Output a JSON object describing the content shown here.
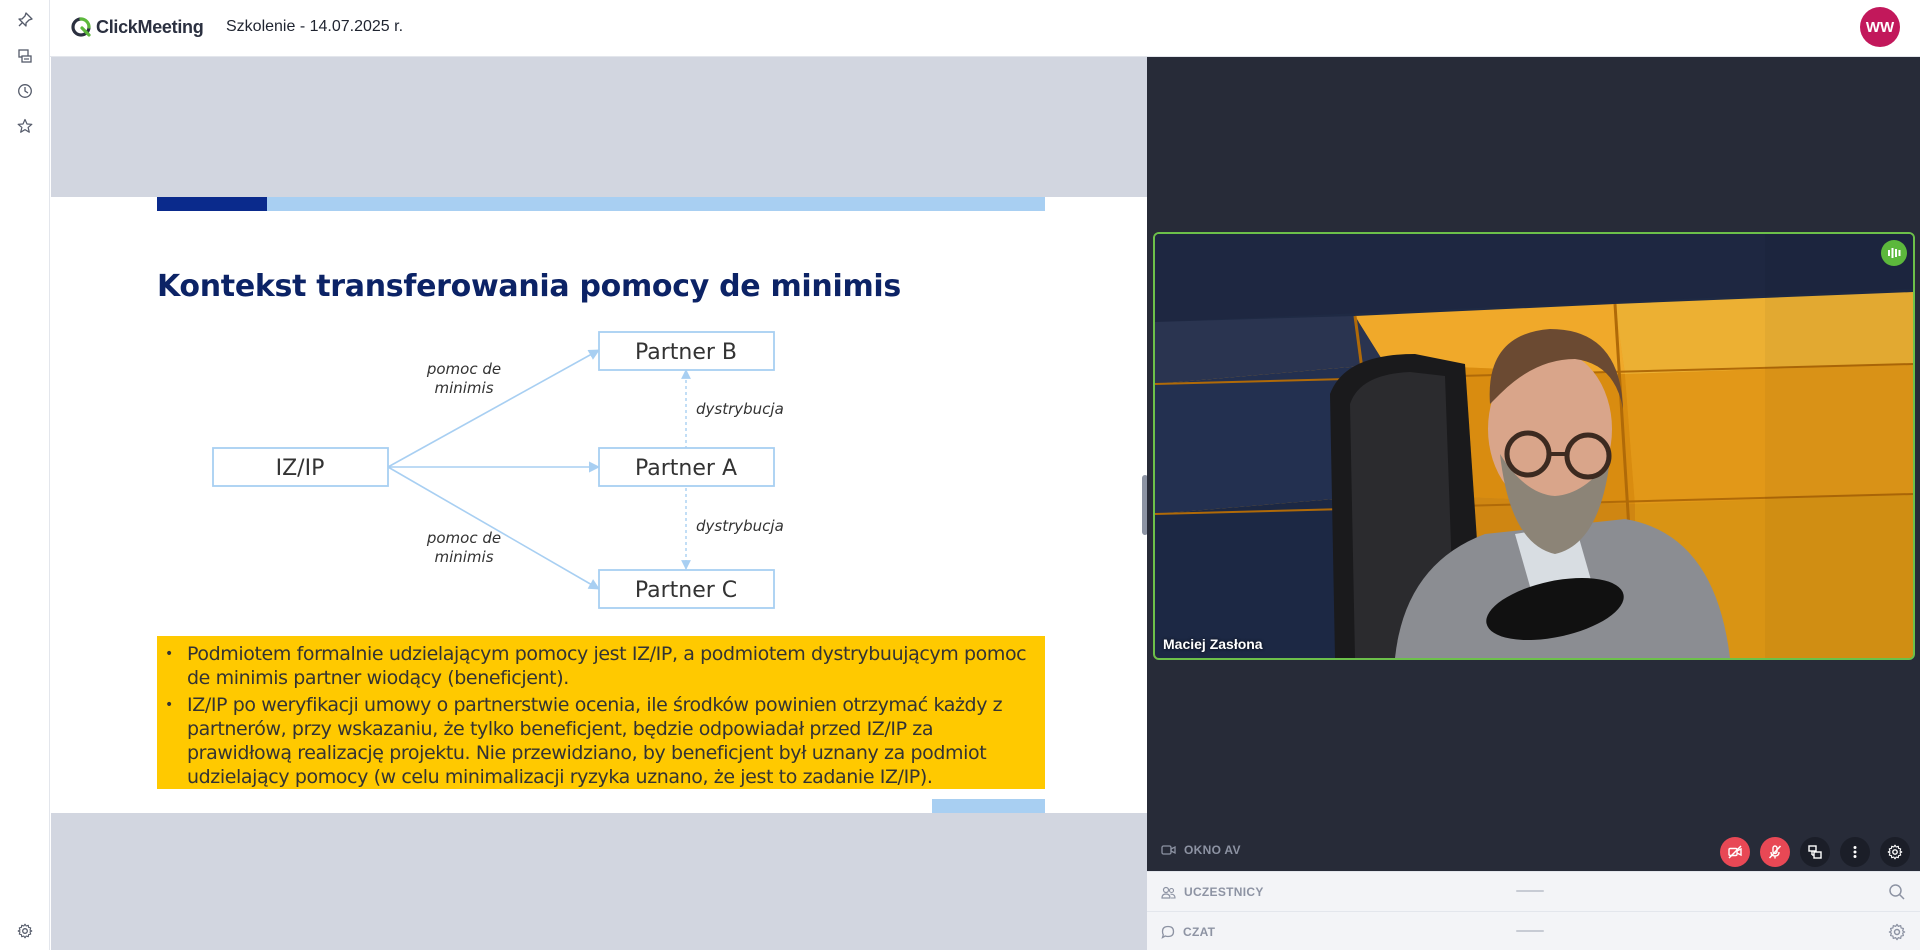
{
  "app": {
    "logo_text": "ClickMeeting",
    "meeting_title": "Szkolenie - 14.07.2025 r.",
    "user_initials": "WW",
    "accent_color": "#c2185b",
    "brand_color": "#5cb83c"
  },
  "rail": {
    "icons": [
      "pin-icon",
      "presentation-icon",
      "history-icon",
      "star-icon",
      "settings-icon"
    ]
  },
  "slide": {
    "title": "Kontekst transferowania pomocy de minimis",
    "diagram": {
      "source": "IZ/IP",
      "partner_b": "Partner B",
      "partner_a": "Partner A",
      "partner_c": "Partner C",
      "edge_top_line1": "pomoc de",
      "edge_top_line2": "minimis",
      "edge_bottom_line1": "pomoc de",
      "edge_bottom_line2": "minimis",
      "dist_top": "dystrybucja",
      "dist_bottom": "dystrybucja"
    },
    "bullets": [
      "Podmiotem formalnie udzielającym pomocy jest IZ/IP, a podmiotem dystrybuującym pomoc de minimis partner wiodący (beneficjent).",
      "IZ/IP po weryfikacji umowy o partnerstwie ocenia, ile środków powinien otrzymać każdy z partnerów, przy wskazaniu, że tylko beneficjent, będzie odpowiadał przed IZ/IP za prawidłową realizację projektu. Nie przewidziano, by beneficjent był uznany za podmiot udzielający pomocy (w celu minimalizacji ryzyka uznano, że jest to zadanie IZ/IP)."
    ]
  },
  "video": {
    "participant_name": "Maciej Zasłona"
  },
  "panel": {
    "av_label": "OKNO AV",
    "participants_label": "UCZESTNICY",
    "chat_label": "CZAT"
  }
}
